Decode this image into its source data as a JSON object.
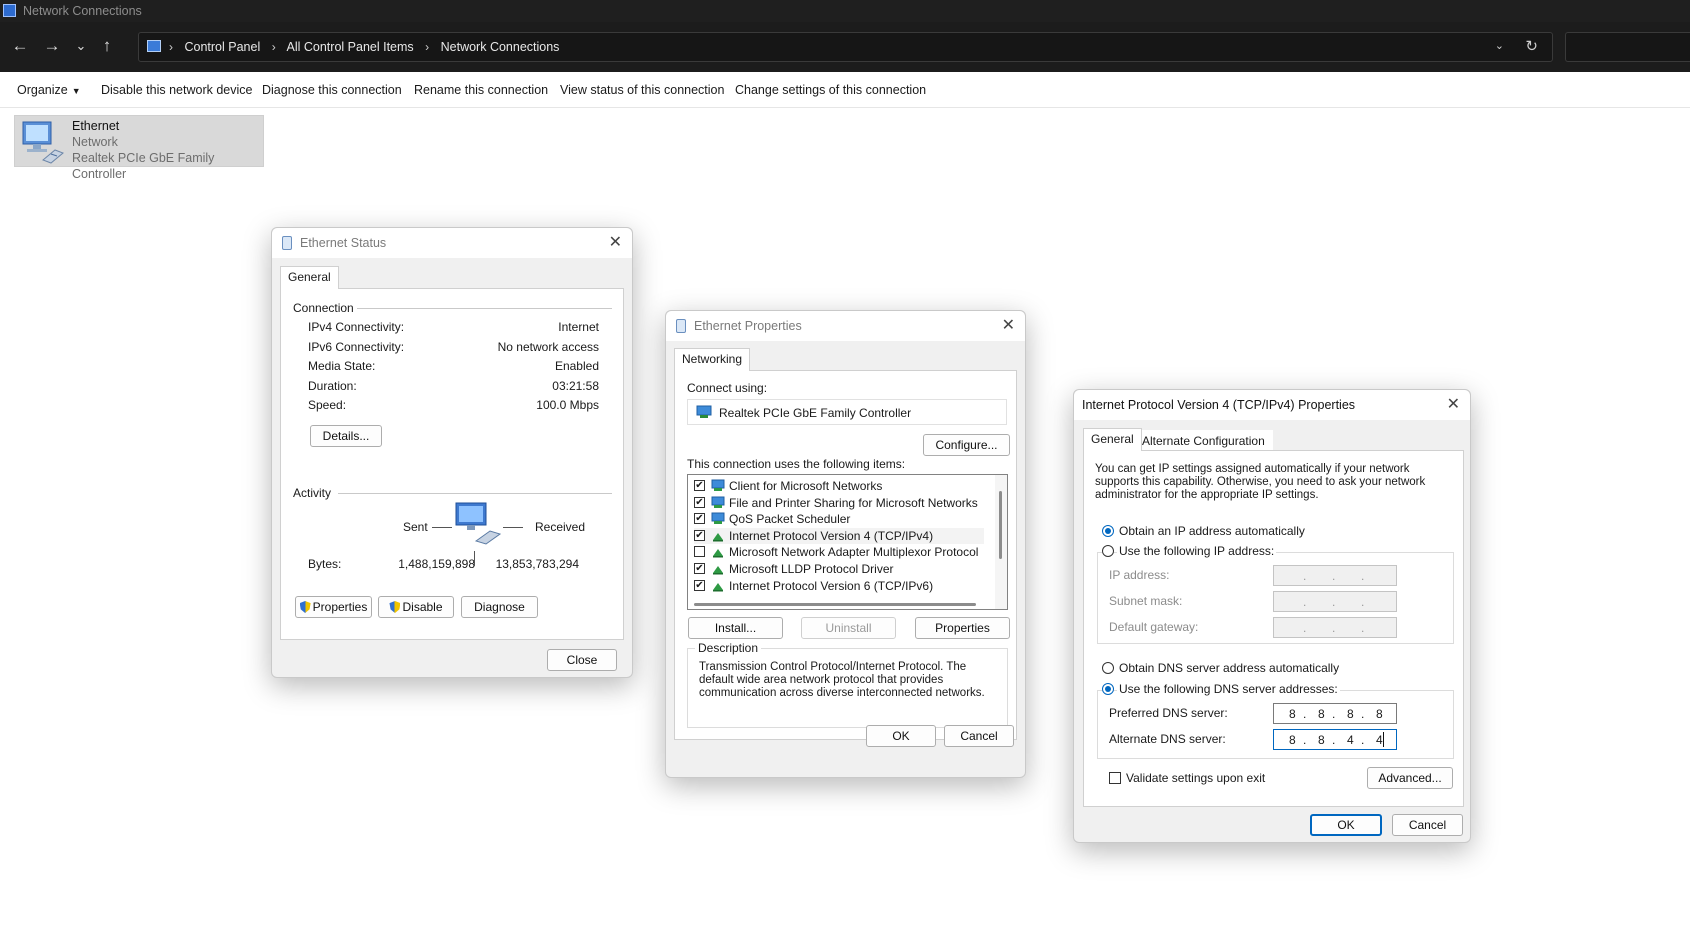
{
  "window": {
    "title": "Network Connections"
  },
  "nav": {
    "back": "←",
    "forward": "→",
    "recent": "⌄",
    "up": "↑"
  },
  "breadcrumb": [
    "Control Panel",
    "All Control Panel Items",
    "Network Connections"
  ],
  "address_dropdown": "⌄",
  "address_refresh": "↻",
  "commandbar": {
    "organize": "Organize",
    "disable": "Disable this network device",
    "diagnose": "Diagnose this connection",
    "rename": "Rename this connection",
    "view_status": "View status of this connection",
    "change_settings": "Change settings of this connection"
  },
  "network_item": {
    "name": "Ethernet",
    "status": "Network",
    "adapter": "Realtek PCIe GbE Family Controller"
  },
  "ethernet_status": {
    "title": "Ethernet Status",
    "tab": "General",
    "connection_label": "Connection",
    "rows": [
      {
        "label": "IPv4 Connectivity:",
        "value": "Internet"
      },
      {
        "label": "IPv6 Connectivity:",
        "value": "No network access"
      },
      {
        "label": "Media State:",
        "value": "Enabled"
      },
      {
        "label": "Duration:",
        "value": "03:21:58"
      },
      {
        "label": "Speed:",
        "value": "100.0 Mbps"
      }
    ],
    "details_button": "Details...",
    "activity_label": "Activity",
    "sent_label": "Sent",
    "received_label": "Received",
    "bytes_label": "Bytes:",
    "bytes_sent": "1,488,159,898",
    "bytes_received": "13,853,783,294",
    "properties_button": "Properties",
    "disable_button": "Disable",
    "diagnose_button": "Diagnose",
    "close_button": "Close"
  },
  "ethernet_properties": {
    "title": "Ethernet Properties",
    "tab": "Networking",
    "connect_using_label": "Connect using:",
    "adapter": "Realtek PCIe GbE Family Controller",
    "configure_button": "Configure...",
    "items_label": "This connection uses the following items:",
    "items": [
      {
        "label": "Client for Microsoft Networks",
        "checked": true,
        "icon": "network-client-icon"
      },
      {
        "label": "File and Printer Sharing for Microsoft Networks",
        "checked": true,
        "icon": "network-client-icon"
      },
      {
        "label": "QoS Packet Scheduler",
        "checked": true,
        "icon": "network-client-icon"
      },
      {
        "label": "Internet Protocol Version 4 (TCP/IPv4)",
        "checked": true,
        "icon": "protocol-icon"
      },
      {
        "label": "Microsoft Network Adapter Multiplexor Protocol",
        "checked": false,
        "icon": "protocol-icon"
      },
      {
        "label": "Microsoft LLDP Protocol Driver",
        "checked": true,
        "icon": "protocol-icon"
      },
      {
        "label": "Internet Protocol Version 6 (TCP/IPv6)",
        "checked": true,
        "icon": "protocol-icon"
      }
    ],
    "install_button": "Install...",
    "uninstall_button": "Uninstall",
    "properties_button": "Properties",
    "description_label": "Description",
    "description_text": "Transmission Control Protocol/Internet Protocol. The default wide area network protocol that provides communication across diverse interconnected networks.",
    "ok_button": "OK",
    "cancel_button": "Cancel"
  },
  "ipv4_properties": {
    "title": "Internet Protocol Version 4 (TCP/IPv4) Properties",
    "tab_general": "General",
    "tab_alternate": "Alternate Configuration",
    "intro": "You can get IP settings assigned automatically if your network supports this capability. Otherwise, you need to ask your network administrator for the appropriate IP settings.",
    "obtain_ip_auto": "Obtain an IP address automatically",
    "use_following_ip": "Use the following IP address:",
    "ip_address_label": "IP address:",
    "subnet_mask_label": "Subnet mask:",
    "default_gateway_label": "Default gateway:",
    "obtain_dns_auto": "Obtain DNS server address automatically",
    "use_following_dns": "Use the following DNS server addresses:",
    "preferred_dns_label": "Preferred DNS server:",
    "alternate_dns_label": "Alternate DNS server:",
    "preferred_dns": [
      "8",
      "8",
      "8",
      "8"
    ],
    "alternate_dns": [
      "8",
      "8",
      "4",
      "4"
    ],
    "validate_label": "Validate settings upon exit",
    "advanced_button": "Advanced...",
    "ok_button": "OK",
    "cancel_button": "Cancel"
  },
  "colors": {
    "accent": "#0067c0",
    "titlebar_dark": "#1f1f1f",
    "selected_item": "#d9d9d9"
  }
}
